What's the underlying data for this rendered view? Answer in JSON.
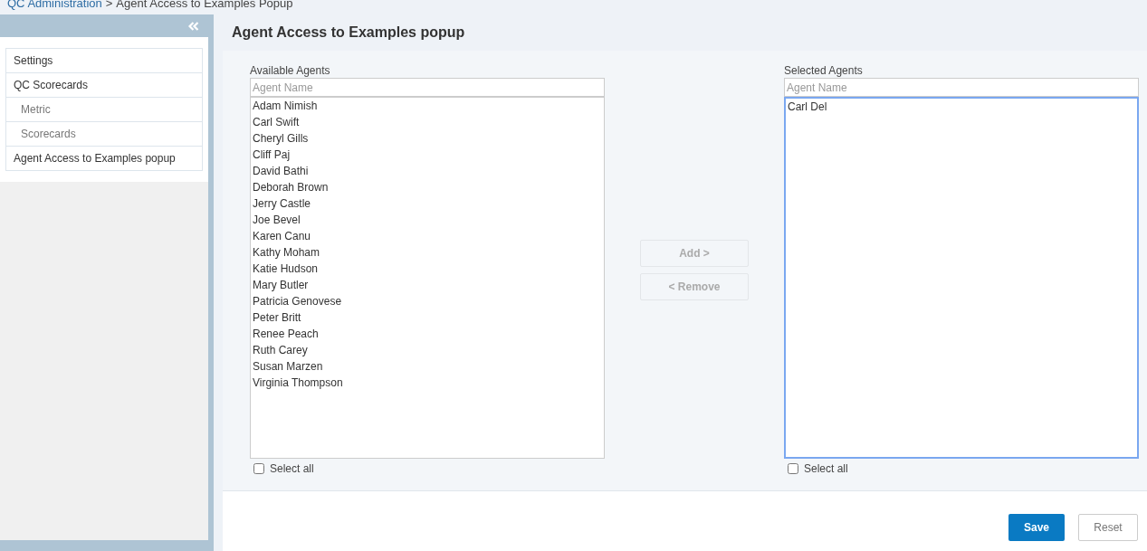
{
  "breadcrumb": {
    "link": "QC Administration",
    "separator": ">",
    "current": "Agent Access to Examples Popup"
  },
  "sidebar": {
    "items": [
      {
        "label": "Settings"
      },
      {
        "label": "QC Scorecards",
        "children": [
          {
            "label": "Metric"
          },
          {
            "label": "Scorecards"
          }
        ]
      },
      {
        "label": "Agent Access to Examples popup"
      }
    ]
  },
  "page_title": "Agent Access to Examples popup",
  "available": {
    "label": "Available Agents",
    "placeholder": "Agent Name",
    "focused": false,
    "agents": [
      "Adam Nimish",
      "Carl Swift",
      "Cheryl Gills",
      "Cliff Paj",
      "David Bathi",
      "Deborah Brown",
      "Jerry Castle",
      "Joe Bevel",
      "Karen Canu",
      "Kathy Moham",
      "Katie Hudson",
      "Mary Butler",
      "Patricia Genovese",
      "Peter Britt",
      "Renee Peach",
      "Ruth Carey",
      "Susan Marzen",
      "Virginia Thompson"
    ],
    "select_all": {
      "label": "Select all",
      "checked": false
    }
  },
  "actions": [
    {
      "label": "Add >",
      "disabled": true
    },
    {
      "label": "< Remove",
      "disabled": true
    }
  ],
  "selected": {
    "label": "Selected Agents",
    "placeholder": "Agent Name",
    "focused": true,
    "agents": [
      "Carl Del"
    ],
    "select_all": {
      "label": "Select all",
      "checked": false
    }
  },
  "footer_buttons": [
    {
      "label": "Save",
      "kind": "primary"
    },
    {
      "label": "Reset",
      "kind": "secondary"
    }
  ]
}
